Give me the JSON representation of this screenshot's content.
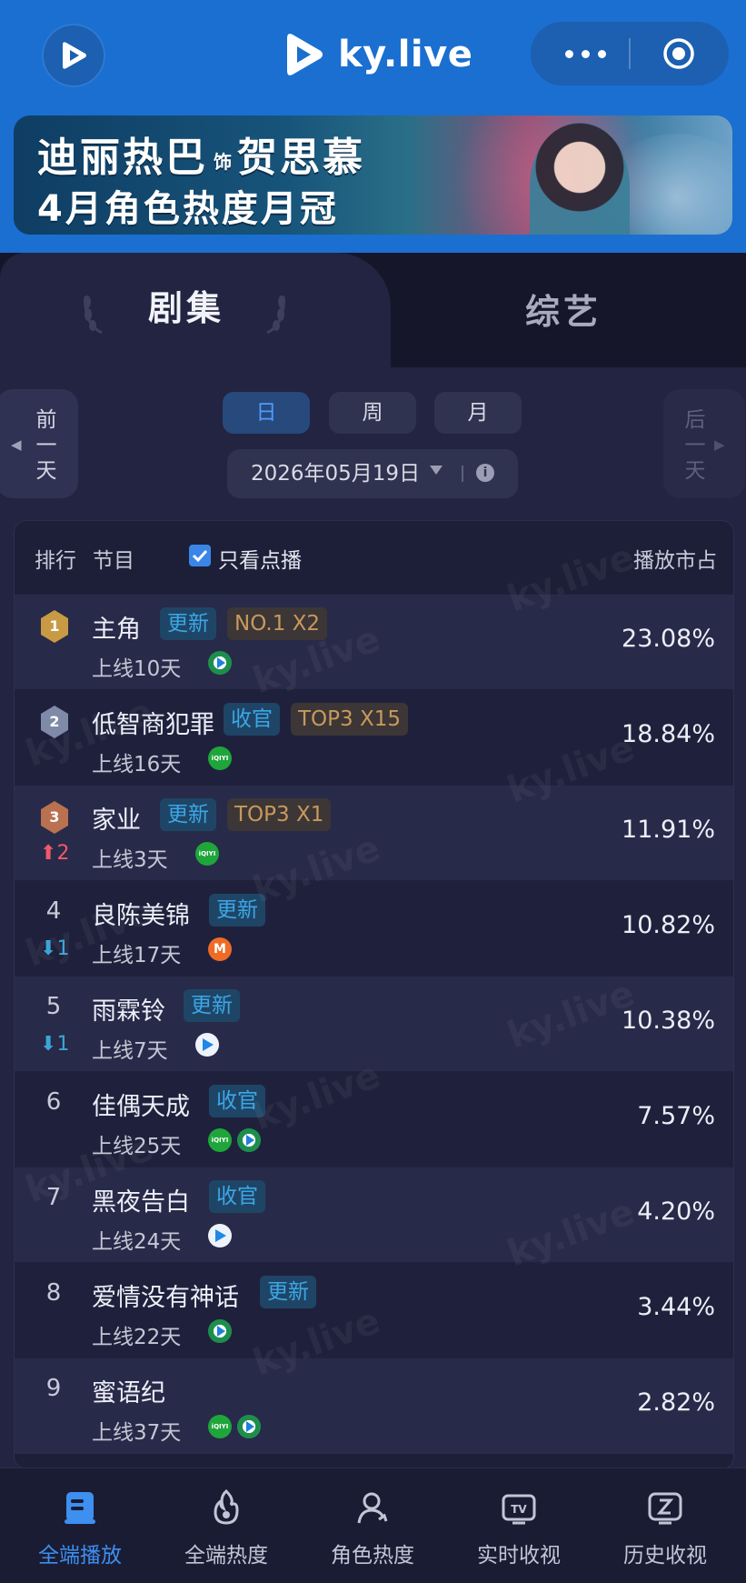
{
  "header": {
    "brand": "ky.live"
  },
  "banner": {
    "name": "迪丽热巴",
    "role_prefix": "饰",
    "role": "贺思慕",
    "subtitle": "4月角色热度月冠"
  },
  "categories": [
    "剧集",
    "综艺"
  ],
  "nav": {
    "prev": "前\n一\n天",
    "next": "后\n一\n天"
  },
  "periods": [
    "日",
    "周",
    "月"
  ],
  "date": "2026年05月19日",
  "list_header": {
    "rank": "排行",
    "program": "节目",
    "only_vod": "只看点播",
    "share": "播放市占"
  },
  "rows": [
    {
      "rank": "1",
      "title": "主角",
      "tags": [
        {
          "text": "更新",
          "style": "blue"
        },
        {
          "text": "NO.1 X2",
          "style": "gold"
        }
      ],
      "days": "上线10天",
      "platforms": [
        "tencent"
      ],
      "share": "23.08%",
      "trend": ""
    },
    {
      "rank": "2",
      "title": "低智商犯罪",
      "tags": [
        {
          "text": "收官",
          "style": "blue"
        },
        {
          "text": "TOP3 X15",
          "style": "gold"
        }
      ],
      "days": "上线16天",
      "platforms": [
        "iqiyi"
      ],
      "share": "18.84%",
      "trend": ""
    },
    {
      "rank": "3",
      "title": "家业",
      "tags": [
        {
          "text": "更新",
          "style": "blue"
        },
        {
          "text": "TOP3 X1",
          "style": "gold"
        }
      ],
      "days": "上线3天",
      "platforms": [
        "iqiyi"
      ],
      "share": "11.91%",
      "trend": "2",
      "trend_dir": "up"
    },
    {
      "rank": "4",
      "title": "良陈美锦",
      "tags": [
        {
          "text": "更新",
          "style": "blue"
        }
      ],
      "days": "上线17天",
      "platforms": [
        "mango"
      ],
      "share": "10.82%",
      "trend": "1",
      "trend_dir": "down"
    },
    {
      "rank": "5",
      "title": "雨霖铃",
      "tags": [
        {
          "text": "更新",
          "style": "blue"
        }
      ],
      "days": "上线7天",
      "platforms": [
        "youku"
      ],
      "share": "10.38%",
      "trend": "1",
      "trend_dir": "down"
    },
    {
      "rank": "6",
      "title": "佳偶天成",
      "tags": [
        {
          "text": "收官",
          "style": "blue"
        }
      ],
      "days": "上线25天",
      "platforms": [
        "iqiyi",
        "tencent"
      ],
      "share": "7.57%",
      "trend": ""
    },
    {
      "rank": "7",
      "title": "黑夜告白",
      "tags": [
        {
          "text": "收官",
          "style": "blue"
        }
      ],
      "days": "上线24天",
      "platforms": [
        "youku"
      ],
      "share": "4.20%",
      "trend": ""
    },
    {
      "rank": "8",
      "title": "爱情没有神话",
      "tags": [
        {
          "text": "更新",
          "style": "blue"
        }
      ],
      "days": "上线22天",
      "platforms": [
        "tencent"
      ],
      "share": "3.44%",
      "trend": ""
    },
    {
      "rank": "9",
      "title": "蜜语纪",
      "tags": [],
      "days": "上线37天",
      "platforms": [
        "iqiyi",
        "tencent"
      ],
      "share": "2.82%",
      "trend": ""
    }
  ],
  "tabbar": [
    {
      "label": "全端播放",
      "icon": "play-book-icon",
      "active": true
    },
    {
      "label": "全端热度",
      "icon": "flame-icon",
      "active": false
    },
    {
      "label": "角色热度",
      "icon": "person-icon",
      "active": false
    },
    {
      "label": "实时收视",
      "icon": "tv-icon",
      "active": false
    },
    {
      "label": "历史收视",
      "icon": "history-icon",
      "active": false
    }
  ],
  "colors": {
    "accent": "#1a6fd0",
    "active_tab": "#3d8ff0",
    "tag_blue": "#3ca7e6",
    "tag_gold": "#c9995a",
    "up": "#f0596a",
    "down": "#3aa6d8",
    "medal_gold": "#c99a44",
    "medal_silver": "#7e8aa8",
    "medal_bronze": "#b9714f"
  }
}
